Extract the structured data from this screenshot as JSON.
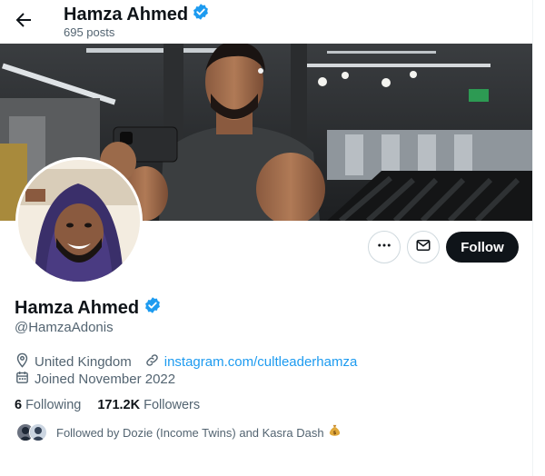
{
  "header": {
    "name": "Hamza Ahmed",
    "posts": "695 posts"
  },
  "profile": {
    "name": "Hamza Ahmed",
    "handle": "@HamzaAdonis",
    "location": "United Kingdom",
    "website": "instagram.com/cultleaderhamza",
    "joined": "Joined November 2022",
    "following_count": "6",
    "following_label": "Following",
    "followers_count": "171.2K",
    "followers_label": "Followers",
    "followed_by": "Followed by Dozie (Income Twins) and Kasra Dash"
  },
  "actions": {
    "follow_label": "Follow"
  },
  "colors": {
    "accent": "#1d9bf0",
    "verified": "#1d9bf0",
    "follow_bg": "#0f1419"
  },
  "icons": [
    "back-arrow-icon",
    "verified-badge-icon",
    "more-icon",
    "mail-icon",
    "location-icon",
    "link-icon",
    "calendar-icon",
    "money-bag-icon"
  ]
}
